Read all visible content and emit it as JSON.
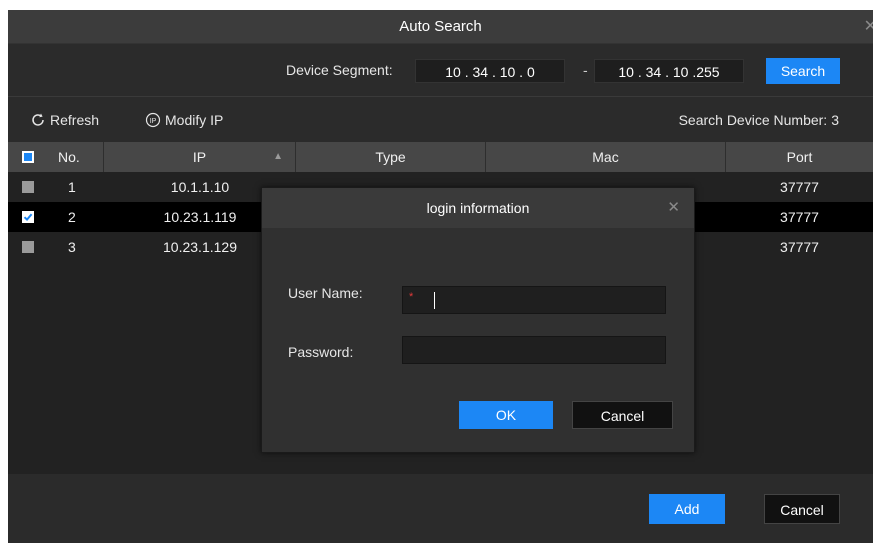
{
  "window": {
    "title": "Auto Search"
  },
  "segment": {
    "label": "Device Segment:",
    "start": "10 . 34 . 10 . 0",
    "separator": "-",
    "end": "10 . 34 . 10 .255",
    "search_label": "Search"
  },
  "toolbar": {
    "refresh_label": "Refresh",
    "modify_ip_label": "Modify IP",
    "count_label": "Search Device Number:",
    "count_value": "3"
  },
  "table": {
    "headers": {
      "no": "No.",
      "ip": "IP",
      "type": "Type",
      "mac": "Mac",
      "port": "Port"
    },
    "rows": [
      {
        "no": "1",
        "ip": "10.1.1.10",
        "type": "",
        "mac": "",
        "port": "37777",
        "checked": false
      },
      {
        "no": "2",
        "ip": "10.23.1.119",
        "type": "",
        "mac": "",
        "port": "37777",
        "checked": true
      },
      {
        "no": "3",
        "ip": "10.23.1.129",
        "type": "",
        "mac": "",
        "port": "37777",
        "checked": false
      }
    ]
  },
  "footer": {
    "add_label": "Add",
    "cancel_label": "Cancel"
  },
  "login": {
    "title": "login information",
    "username_label": "User Name:",
    "username_value": "",
    "required_mark": "*",
    "password_label": "Password:",
    "password_value": "",
    "ok_label": "OK",
    "cancel_label": "Cancel"
  },
  "colors": {
    "accent": "#1c87f5",
    "background": "#2b2b2b",
    "header_bg": "#474747",
    "selected_row": "#000000",
    "required": "#e23a3a"
  }
}
